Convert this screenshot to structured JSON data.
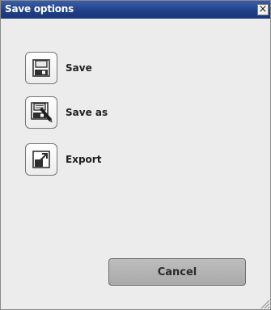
{
  "window": {
    "title": "Save options",
    "close_glyph": "×",
    "close_icon": "close-icon"
  },
  "options": [
    {
      "label": "Save",
      "icon": "floppy-disk-icon"
    },
    {
      "label": "Save as",
      "icon": "floppy-disk-pencil-icon"
    },
    {
      "label": "Export",
      "icon": "export-icon"
    }
  ],
  "footer": {
    "cancel_label": "Cancel"
  },
  "colors": {
    "titlebar": "#1f3f86",
    "dialog_background": "#ececec",
    "cancel_button": "#b3b3b3"
  }
}
